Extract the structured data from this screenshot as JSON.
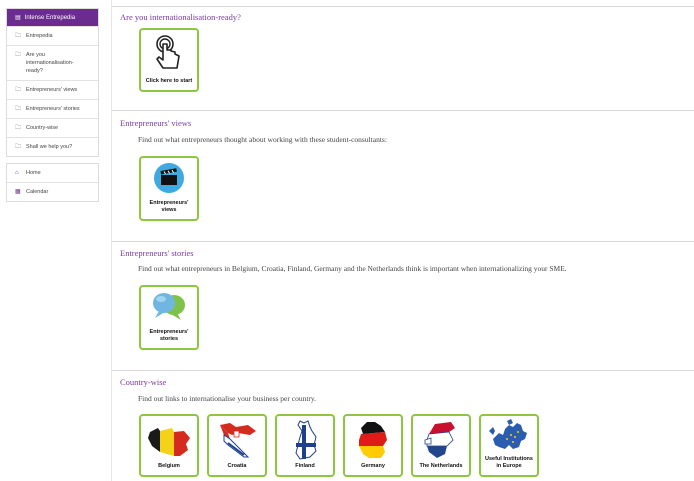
{
  "sidebar": {
    "header": "Intense Entrepedia",
    "items": [
      {
        "label": "Entrepedia",
        "icon": "folder-icon"
      },
      {
        "label": "Are you internationalisation-ready?",
        "icon": "folder-icon"
      },
      {
        "label": "Entrepreneurs' views",
        "icon": "folder-icon"
      },
      {
        "label": "Entrepreneurs' stories",
        "icon": "folder-icon"
      },
      {
        "label": "Country-wise",
        "icon": "folder-icon"
      },
      {
        "label": "Shall we help you?",
        "icon": "folder-icon"
      }
    ],
    "extra": [
      {
        "label": "Home",
        "icon": "home-icon"
      },
      {
        "label": "Calendar",
        "icon": "calendar-icon"
      }
    ]
  },
  "sections": {
    "ready": {
      "title": "Are you internationalisation-ready?",
      "tile_label": "Click here to start"
    },
    "views": {
      "title": "Entrepreneurs' views",
      "desc": "Find out what entrepreneurs thought about working with these student-consultants:",
      "tile_label_1": "Entrepreneurs'",
      "tile_label_2": "views"
    },
    "stories": {
      "title": "Entrepreneurs' stories",
      "desc": "Find out what entrepreneurs in Belgium, Croatia, Finland, Germany and the Netherlands think is important when internationalizing your SME.",
      "tile_label_1": "Entrepreneurs'",
      "tile_label_2": "stories"
    },
    "country": {
      "title": "Country-wise",
      "desc": "Find out links to internationalise your business per country.",
      "tiles": [
        "Belgium",
        "Croatia",
        "Finland",
        "Germany",
        "The Netherlands",
        "Useful Institutions in Europe"
      ]
    }
  },
  "colors": {
    "brand_purple": "#6a2c8e",
    "tile_border_green": "#8dc63f",
    "title_purple": "#7b3aa1"
  }
}
